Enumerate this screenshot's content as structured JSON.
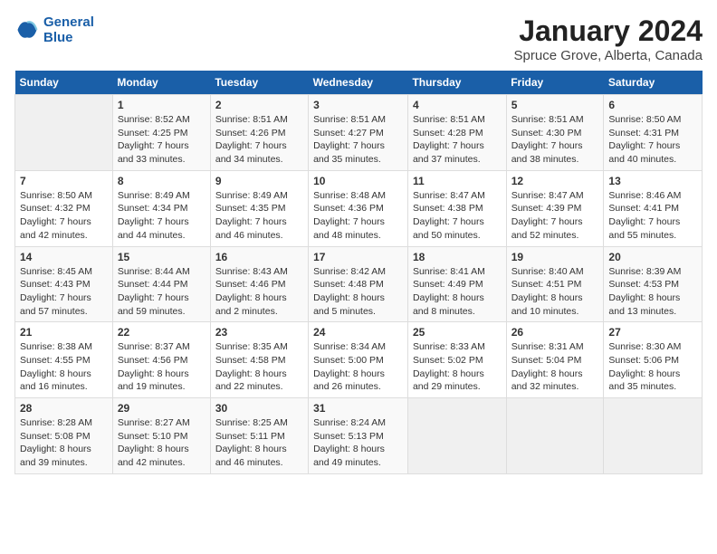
{
  "logo": {
    "line1": "General",
    "line2": "Blue"
  },
  "title": "January 2024",
  "subtitle": "Spruce Grove, Alberta, Canada",
  "days_of_week": [
    "Sunday",
    "Monday",
    "Tuesday",
    "Wednesday",
    "Thursday",
    "Friday",
    "Saturday"
  ],
  "weeks": [
    [
      {
        "num": "",
        "info": ""
      },
      {
        "num": "1",
        "info": "Sunrise: 8:52 AM\nSunset: 4:25 PM\nDaylight: 7 hours\nand 33 minutes."
      },
      {
        "num": "2",
        "info": "Sunrise: 8:51 AM\nSunset: 4:26 PM\nDaylight: 7 hours\nand 34 minutes."
      },
      {
        "num": "3",
        "info": "Sunrise: 8:51 AM\nSunset: 4:27 PM\nDaylight: 7 hours\nand 35 minutes."
      },
      {
        "num": "4",
        "info": "Sunrise: 8:51 AM\nSunset: 4:28 PM\nDaylight: 7 hours\nand 37 minutes."
      },
      {
        "num": "5",
        "info": "Sunrise: 8:51 AM\nSunset: 4:30 PM\nDaylight: 7 hours\nand 38 minutes."
      },
      {
        "num": "6",
        "info": "Sunrise: 8:50 AM\nSunset: 4:31 PM\nDaylight: 7 hours\nand 40 minutes."
      }
    ],
    [
      {
        "num": "7",
        "info": "Sunrise: 8:50 AM\nSunset: 4:32 PM\nDaylight: 7 hours\nand 42 minutes."
      },
      {
        "num": "8",
        "info": "Sunrise: 8:49 AM\nSunset: 4:34 PM\nDaylight: 7 hours\nand 44 minutes."
      },
      {
        "num": "9",
        "info": "Sunrise: 8:49 AM\nSunset: 4:35 PM\nDaylight: 7 hours\nand 46 minutes."
      },
      {
        "num": "10",
        "info": "Sunrise: 8:48 AM\nSunset: 4:36 PM\nDaylight: 7 hours\nand 48 minutes."
      },
      {
        "num": "11",
        "info": "Sunrise: 8:47 AM\nSunset: 4:38 PM\nDaylight: 7 hours\nand 50 minutes."
      },
      {
        "num": "12",
        "info": "Sunrise: 8:47 AM\nSunset: 4:39 PM\nDaylight: 7 hours\nand 52 minutes."
      },
      {
        "num": "13",
        "info": "Sunrise: 8:46 AM\nSunset: 4:41 PM\nDaylight: 7 hours\nand 55 minutes."
      }
    ],
    [
      {
        "num": "14",
        "info": "Sunrise: 8:45 AM\nSunset: 4:43 PM\nDaylight: 7 hours\nand 57 minutes."
      },
      {
        "num": "15",
        "info": "Sunrise: 8:44 AM\nSunset: 4:44 PM\nDaylight: 7 hours\nand 59 minutes."
      },
      {
        "num": "16",
        "info": "Sunrise: 8:43 AM\nSunset: 4:46 PM\nDaylight: 8 hours\nand 2 minutes."
      },
      {
        "num": "17",
        "info": "Sunrise: 8:42 AM\nSunset: 4:48 PM\nDaylight: 8 hours\nand 5 minutes."
      },
      {
        "num": "18",
        "info": "Sunrise: 8:41 AM\nSunset: 4:49 PM\nDaylight: 8 hours\nand 8 minutes."
      },
      {
        "num": "19",
        "info": "Sunrise: 8:40 AM\nSunset: 4:51 PM\nDaylight: 8 hours\nand 10 minutes."
      },
      {
        "num": "20",
        "info": "Sunrise: 8:39 AM\nSunset: 4:53 PM\nDaylight: 8 hours\nand 13 minutes."
      }
    ],
    [
      {
        "num": "21",
        "info": "Sunrise: 8:38 AM\nSunset: 4:55 PM\nDaylight: 8 hours\nand 16 minutes."
      },
      {
        "num": "22",
        "info": "Sunrise: 8:37 AM\nSunset: 4:56 PM\nDaylight: 8 hours\nand 19 minutes."
      },
      {
        "num": "23",
        "info": "Sunrise: 8:35 AM\nSunset: 4:58 PM\nDaylight: 8 hours\nand 22 minutes."
      },
      {
        "num": "24",
        "info": "Sunrise: 8:34 AM\nSunset: 5:00 PM\nDaylight: 8 hours\nand 26 minutes."
      },
      {
        "num": "25",
        "info": "Sunrise: 8:33 AM\nSunset: 5:02 PM\nDaylight: 8 hours\nand 29 minutes."
      },
      {
        "num": "26",
        "info": "Sunrise: 8:31 AM\nSunset: 5:04 PM\nDaylight: 8 hours\nand 32 minutes."
      },
      {
        "num": "27",
        "info": "Sunrise: 8:30 AM\nSunset: 5:06 PM\nDaylight: 8 hours\nand 35 minutes."
      }
    ],
    [
      {
        "num": "28",
        "info": "Sunrise: 8:28 AM\nSunset: 5:08 PM\nDaylight: 8 hours\nand 39 minutes."
      },
      {
        "num": "29",
        "info": "Sunrise: 8:27 AM\nSunset: 5:10 PM\nDaylight: 8 hours\nand 42 minutes."
      },
      {
        "num": "30",
        "info": "Sunrise: 8:25 AM\nSunset: 5:11 PM\nDaylight: 8 hours\nand 46 minutes."
      },
      {
        "num": "31",
        "info": "Sunrise: 8:24 AM\nSunset: 5:13 PM\nDaylight: 8 hours\nand 49 minutes."
      },
      {
        "num": "",
        "info": ""
      },
      {
        "num": "",
        "info": ""
      },
      {
        "num": "",
        "info": ""
      }
    ]
  ]
}
